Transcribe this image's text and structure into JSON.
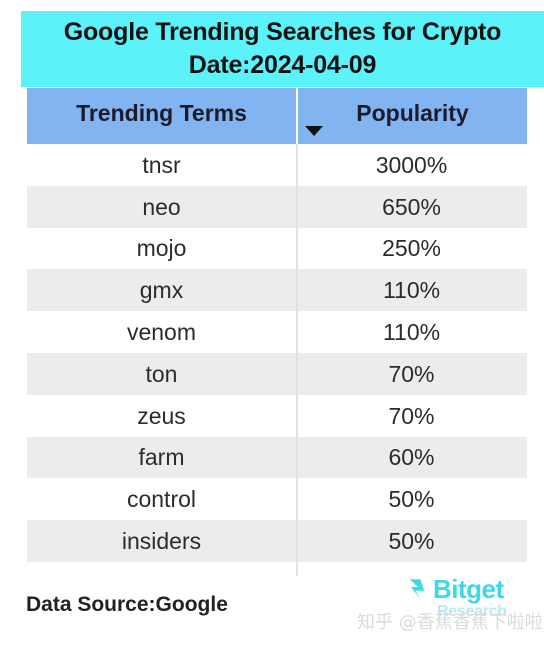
{
  "title": {
    "line1": "Google Trending Searches for Crypto",
    "line2": "Date:2024-04-09"
  },
  "table": {
    "columns": [
      {
        "label": "Trending Terms",
        "sort_indicator": "chevron-down-icon"
      },
      {
        "label": "Popularity"
      }
    ],
    "rows": [
      {
        "term": "tnsr",
        "popularity": "3000%"
      },
      {
        "term": "neo",
        "popularity": "650%"
      },
      {
        "term": "mojo",
        "popularity": "250%"
      },
      {
        "term": "gmx",
        "popularity": "110%"
      },
      {
        "term": "venom",
        "popularity": "110%"
      },
      {
        "term": "ton",
        "popularity": "70%"
      },
      {
        "term": "zeus",
        "popularity": "70%"
      },
      {
        "term": "farm",
        "popularity": "60%"
      },
      {
        "term": "control",
        "popularity": "50%"
      },
      {
        "term": "insiders",
        "popularity": "50%"
      }
    ]
  },
  "footer": {
    "data_source": "Data Source:Google",
    "brand_name": "Bitget",
    "brand_sub": "Research",
    "watermark": "知乎 @香蕉香蕉下啦啦"
  },
  "colors": {
    "title_banner": "#5cf2fa",
    "header_row": "#82b4f2",
    "row_alt": "#ececec",
    "brand": "#3fd8e8",
    "text": "#2c2c2c"
  }
}
